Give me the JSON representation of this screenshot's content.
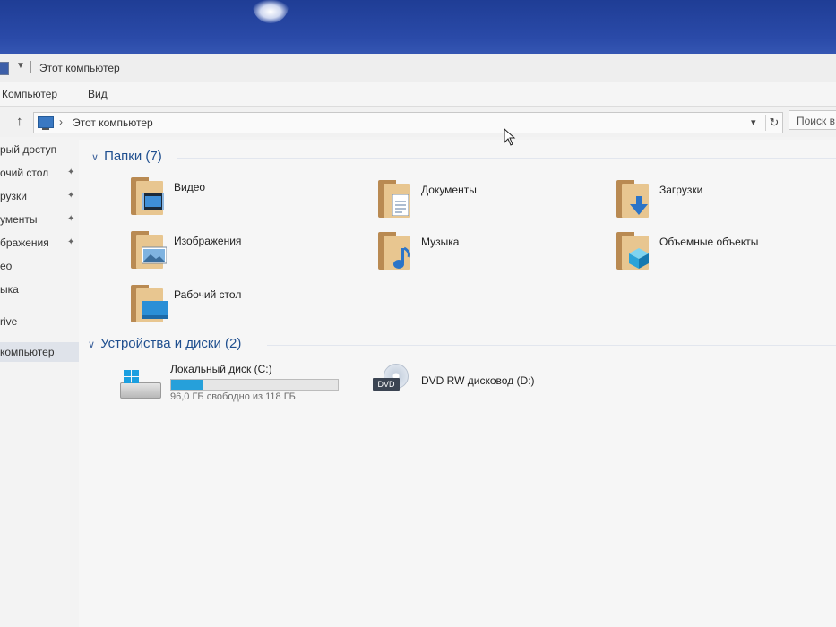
{
  "window": {
    "title": "Этот компьютер"
  },
  "ribbon": {
    "tabs": [
      "Компьютер",
      "Вид"
    ]
  },
  "address_bar": {
    "path": "Этот компьютер",
    "search_placeholder": "Поиск в"
  },
  "sidebar": {
    "items": [
      {
        "label": "рый доступ",
        "pinned": false
      },
      {
        "label": "очий стол",
        "pinned": true
      },
      {
        "label": "рузки",
        "pinned": true
      },
      {
        "label": "ументы",
        "pinned": true
      },
      {
        "label": "бражения",
        "pinned": true
      },
      {
        "label": "ео",
        "pinned": false
      },
      {
        "label": "ыка",
        "pinned": false
      },
      {
        "label": "rive",
        "pinned": false
      },
      {
        "label": "компьютер",
        "pinned": false,
        "selected": true
      }
    ]
  },
  "folders": {
    "header": "Папки (7)",
    "items": [
      {
        "label": "Видео",
        "icon": "video-icon"
      },
      {
        "label": "Документы",
        "icon": "document-icon"
      },
      {
        "label": "Загрузки",
        "icon": "download-arrow-icon"
      },
      {
        "label": "Изображения",
        "icon": "picture-icon"
      },
      {
        "label": "Музыка",
        "icon": "music-note-icon"
      },
      {
        "label": "Объемные объекты",
        "icon": "3d-cube-icon"
      },
      {
        "label": "Рабочий стол",
        "icon": "desktop-icon"
      }
    ]
  },
  "devices": {
    "header": "Устройства и диски (2)",
    "items": [
      {
        "label": "Локальный диск (C:)",
        "free_text": "96,0 ГБ свободно из 118 ГБ",
        "used_fraction": 0.186,
        "icon": "windows-drive-icon"
      },
      {
        "label": "DVD RW дисковод (D:)",
        "icon": "dvd-drive-icon",
        "tag": "DVD"
      }
    ]
  },
  "colors": {
    "accent": "#26a0da",
    "header_text": "#1f4f8f",
    "desktop": "#1d3f8f"
  }
}
